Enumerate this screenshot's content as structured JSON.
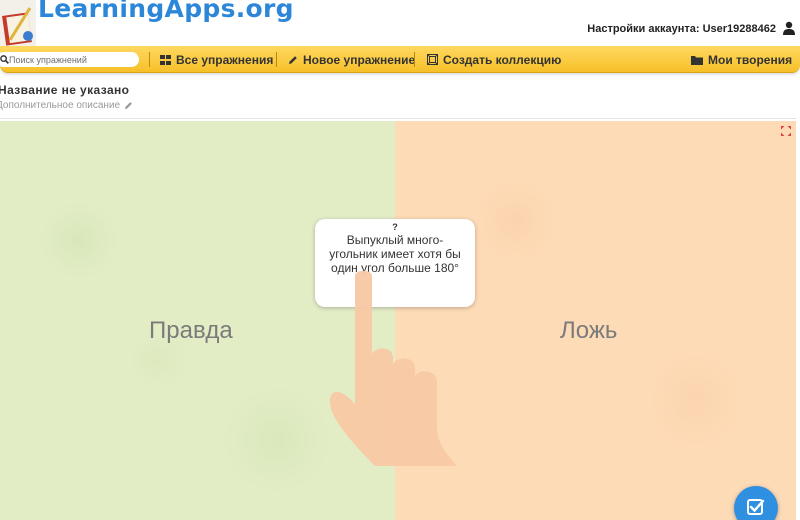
{
  "header": {
    "logo_text": "LearningApps.org",
    "account_label": "Настройки аккаунта: User19288462"
  },
  "nav": {
    "search_placeholder": "Поиск упражнений",
    "items": [
      {
        "label": "Все упражнения",
        "icon": "grid-icon"
      },
      {
        "label": "Новое упражнение",
        "icon": "pencil-icon"
      },
      {
        "label": "Создать коллекцию",
        "icon": "collection-icon"
      },
      {
        "label": "Мои творения",
        "icon": "folder-icon"
      }
    ]
  },
  "exercise": {
    "title": "Название не указано",
    "description": "Дополнительное описание"
  },
  "app": {
    "left_label": "Правда",
    "right_label": "Ложь",
    "card_question_mark": "?",
    "card_text": "Выпуклый много-угольник имеет хотя бы один угол больше 180°",
    "colors": {
      "left_zone": "#e2edc6",
      "right_zone": "#fedbb7",
      "check_button": "#2f8fe0"
    }
  }
}
